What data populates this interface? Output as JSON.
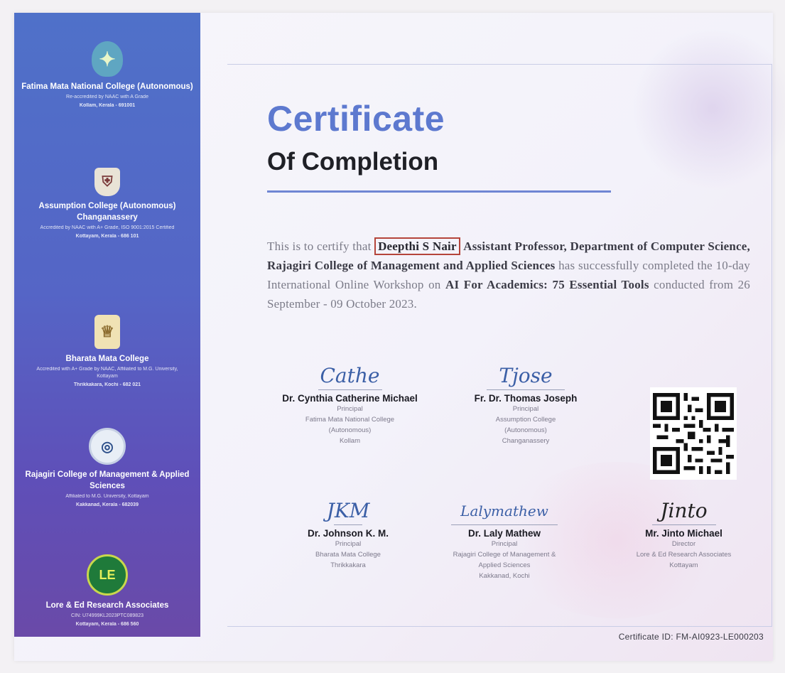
{
  "certificate": {
    "title": "Certificate",
    "subtitle": "Of Completion",
    "body": {
      "lead": "This is to certify that",
      "recipient": "Deepthi S Nair",
      "designation": "Assistant Professor, Department of Computer Science, Rajagiri College of Management and Applied Sciences",
      "middle": "has successfully completed the 10-day International Online Workshop on",
      "program": "AI For Academics: 75 Essential Tools",
      "tail": "conducted from 26 September - 09 October 2023."
    },
    "certificate_id": "Certificate ID: FM-AI0923-LE000203"
  },
  "sidebar": {
    "institutions": [
      {
        "name": "Fatima Mata National College (Autonomous)",
        "subtitle": "Re-accredited by NAAC with A Grade",
        "location": "Kollam, Kerala - 691001",
        "logo_icon": "star-emblem"
      },
      {
        "name": "Assumption College (Autonomous) Changanassery",
        "subtitle": "Accredited by NAAC with A+ Grade, ISO 9001:2015 Certified",
        "location": "Kottayam, Kerala - 686 101",
        "logo_icon": "crest"
      },
      {
        "name": "Bharata Mata College",
        "subtitle": "Accredited with A+ Grade by NAAC, Affiliated to M.G. University, Kottayam",
        "location": "Thrikkakara, Kochi - 682 021",
        "logo_icon": "figure"
      },
      {
        "name": "Rajagiri College of Management & Applied Sciences",
        "subtitle": "Affiliated to M.G. University, Kottayam",
        "location": "Kakkanad, Kerala - 682039",
        "logo_icon": "seal"
      },
      {
        "name": "Lore & Ed Research Associates",
        "subtitle": "CIN: U74999KL2023PTC089823",
        "location": "Kottayam, Kerala - 686 560",
        "logo_icon": "LE"
      }
    ]
  },
  "signatories": {
    "top": [
      {
        "signature": "Cathe",
        "name": "Dr. Cynthia Catherine Michael",
        "role": "Principal",
        "org": [
          "Fatima Mata National College",
          "(Autonomous)",
          "Kollam"
        ]
      },
      {
        "signature": "Tjose",
        "name": "Fr. Dr. Thomas Joseph",
        "role": "Principal",
        "org": [
          "Assumption College",
          "(Autonomous)",
          "Changanassery"
        ]
      }
    ],
    "bottom": [
      {
        "signature": "JKM",
        "name": "Dr. Johnson K. M.",
        "role": "Principal",
        "org": [
          "Bharata Mata College",
          "Thrikkakara"
        ]
      },
      {
        "signature": "Lalymathew",
        "name": "Dr. Laly Mathew",
        "role": "Principal",
        "org": [
          "Rajagiri College of Management &",
          "Applied Sciences",
          "Kakkanad, Kochi"
        ]
      },
      {
        "signature": "Jinto",
        "name": "Mr. Jinto Michael",
        "role": "Director",
        "org": [
          "Lore & Ed Research Associates",
          "Kottayam"
        ]
      }
    ]
  },
  "qr": {
    "icon": "qr-code"
  },
  "colors": {
    "title": "#5d79cf",
    "sidebar_top": "#4f71c9",
    "sidebar_bottom": "#6a4aa8",
    "highlight_box": "#b5453b"
  }
}
